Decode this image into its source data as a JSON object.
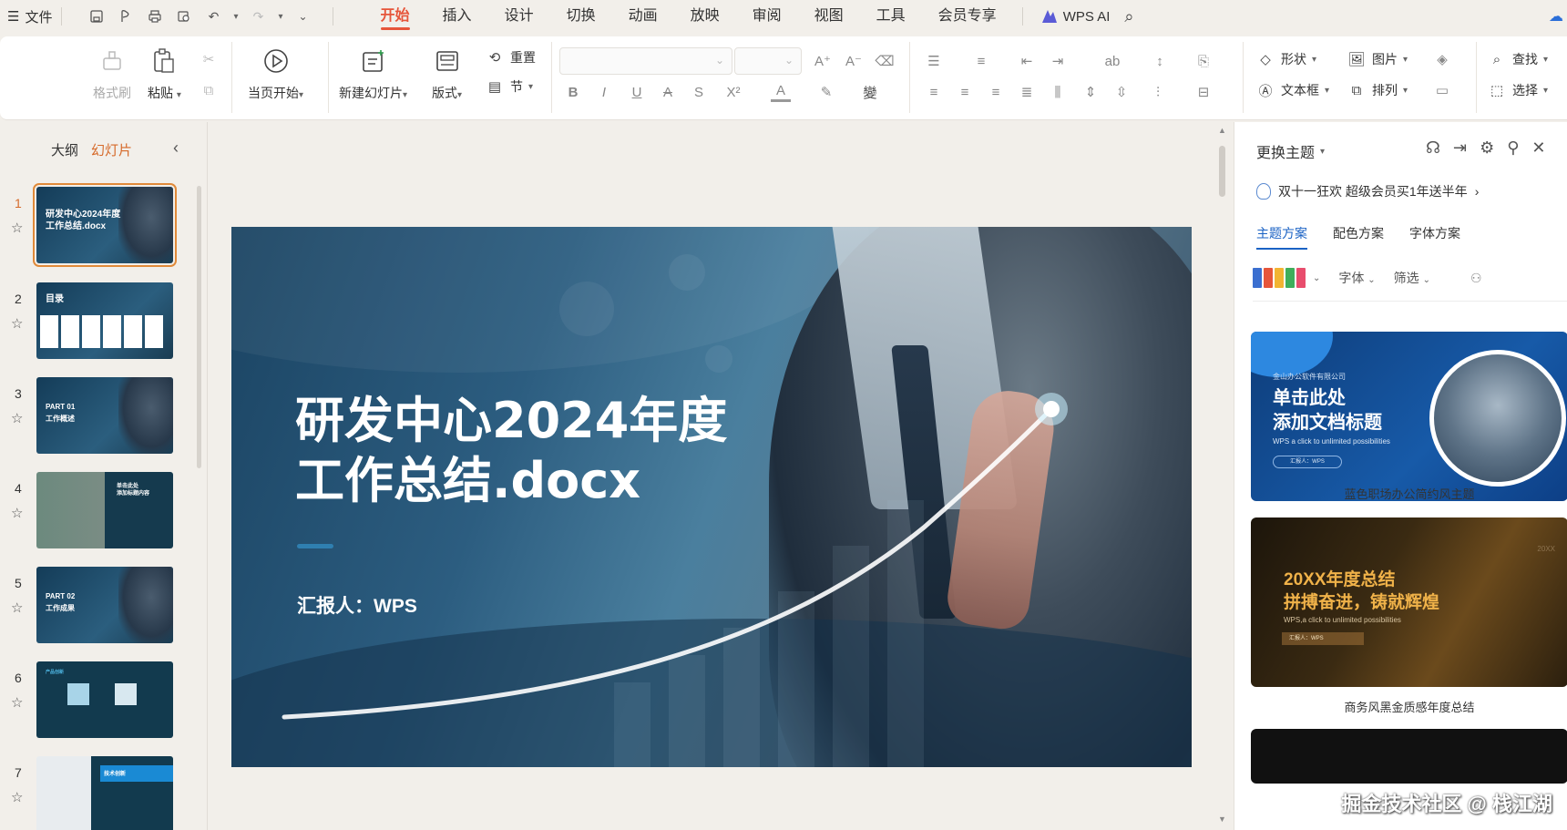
{
  "menubar": {
    "file_label": "文件",
    "tabs": [
      {
        "label": "开始",
        "active": true
      },
      {
        "label": "插入"
      },
      {
        "label": "设计"
      },
      {
        "label": "切换"
      },
      {
        "label": "动画"
      },
      {
        "label": "放映"
      },
      {
        "label": "审阅"
      },
      {
        "label": "视图"
      },
      {
        "label": "工具"
      },
      {
        "label": "会员专享"
      }
    ],
    "wps_ai_label": "WPS AI",
    "accent_color": "#e6553a"
  },
  "ribbon": {
    "format_painter": "格式刷",
    "paste": "粘贴",
    "start_from_current": "当页开始",
    "new_slide": "新建幻灯片",
    "layout": "版式",
    "reset": "重置",
    "section": "节",
    "shape": "形状",
    "picture": "图片",
    "textbox": "文本框",
    "arrange": "排列",
    "find": "查找",
    "select": "选择"
  },
  "left_panel": {
    "tab_outline": "大纲",
    "tab_slides": "幻灯片",
    "slides": [
      {
        "num": "1",
        "title": "研发中心2024年度\n工作总结.docx",
        "active": true
      },
      {
        "num": "2",
        "title": "目录"
      },
      {
        "num": "3",
        "title": "PART 01\n工作概述"
      },
      {
        "num": "4",
        "title": "单击此处\n添加标题内容"
      },
      {
        "num": "5",
        "title": "PART 02\n工作成果"
      },
      {
        "num": "6",
        "title": "产品创新"
      },
      {
        "num": "7",
        "title": "技术创新"
      }
    ]
  },
  "slide": {
    "title_line1": "研发中心2024年度",
    "title_line2": "工作总结.docx",
    "reporter": "汇报人：WPS"
  },
  "right_panel": {
    "header": "更换主题",
    "promo": "双十一狂欢 超级会员买1年送半年",
    "subtabs": [
      {
        "label": "主题方案",
        "active": true
      },
      {
        "label": "配色方案"
      },
      {
        "label": "字体方案"
      }
    ],
    "filter_font": "字体",
    "filter_filter": "筛选",
    "swatch_colors": [
      "#3b6fd0",
      "#e6553a",
      "#f2b432",
      "#3fae5b",
      "#e84d6d"
    ],
    "themes": [
      {
        "company": "金山办公软件有限公司",
        "title": "单击此处\n添加文档标题",
        "subtitle": "WPS a click to unlimited possibilities",
        "pill": "汇报人：WPS",
        "label": "蓝色职场办公简约风主题"
      },
      {
        "corner": "20XX",
        "title": "20XX年度总结\n拼搏奋进，铸就辉煌",
        "subtitle": "WPS,a click to unlimited possibilities",
        "pill": "汇报人：WPS",
        "label": "商务风黑金质感年度总结"
      }
    ]
  },
  "watermark": "掘金技术社区 @ 栈江湖"
}
